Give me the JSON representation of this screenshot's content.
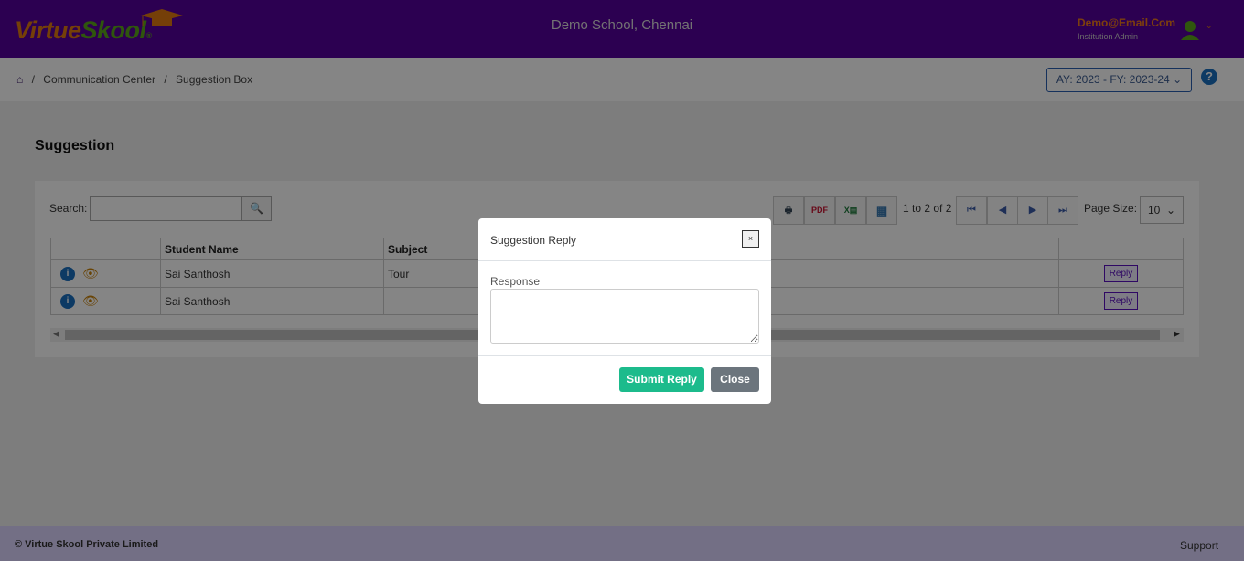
{
  "header": {
    "logo_part1": "Virtue",
    "logo_part2": "Skool",
    "logo_mark": "®",
    "school": "Demo School, Chennai",
    "email": "Demo@Email.Com",
    "role": "Institution Admin"
  },
  "breadcrumb": {
    "items": [
      "Communication Center",
      "Suggestion Box"
    ],
    "separator": "/"
  },
  "year_selector": "AY: 2023 - FY: 2023-24",
  "help": "?",
  "page_title": "Suggestion",
  "grid": {
    "search_label": "Search:",
    "search_value": "",
    "count": "1 to 2 of 2",
    "page_size_label": "Page Size:",
    "page_size": "10",
    "columns": [
      "",
      "Student Name",
      "Subject",
      ""
    ],
    "rows": [
      {
        "student": "Sai Santhosh",
        "subject": "Tour",
        "action": "Reply"
      },
      {
        "student": "Sai Santhosh",
        "subject": "",
        "action": "Reply"
      }
    ],
    "toolbar_icons": [
      "print-icon",
      "pdf-icon",
      "excel-icon",
      "column-chooser-icon"
    ]
  },
  "modal": {
    "title": "Suggestion Reply",
    "close_x": "×",
    "response_label": "Response",
    "response_value": "",
    "submit": "Submit Reply",
    "close": "Close"
  },
  "footer": {
    "copyright": "© Virtue Skool Private Limited",
    "support": "Support"
  },
  "colors": {
    "header": "#55009c",
    "submit": "#1cbb8c",
    "close": "#6c757d",
    "reply": "#5a10c0"
  }
}
